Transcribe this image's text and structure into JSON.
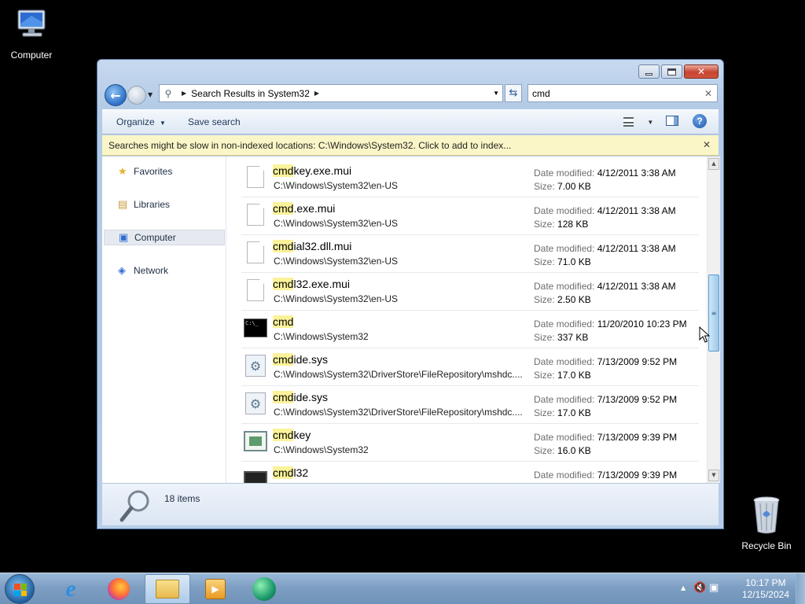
{
  "desktop": {
    "icons": [
      {
        "label": "Computer",
        "icon": "computer-icon"
      },
      {
        "label": "Recycle Bin",
        "icon": "recycle-bin-icon"
      }
    ]
  },
  "window": {
    "caption_buttons": {
      "minimize": "minimize",
      "maximize": "maximize",
      "close": "✕"
    },
    "address": {
      "segments": [
        "Search Results in System32"
      ]
    },
    "search": {
      "value": "cmd"
    },
    "toolbar": {
      "organize_label": "Organize",
      "save_search_label": "Save search"
    },
    "infobar": {
      "text": "Searches might be slow in non-indexed locations: C:\\Windows\\System32. Click to add to index..."
    },
    "navpane": {
      "items": [
        {
          "label": "Favorites",
          "icon": "star-icon",
          "selected": false
        },
        {
          "label": "Libraries",
          "icon": "libraries-icon",
          "selected": false
        },
        {
          "label": "Computer",
          "icon": "computer-icon",
          "selected": true
        },
        {
          "label": "Network",
          "icon": "network-icon",
          "selected": false
        }
      ]
    },
    "files": {
      "date_key": "Date modified:",
      "size_key": "Size:",
      "rows": [
        {
          "match": "cmd",
          "rest": "key.exe.mui",
          "path": "C:\\Windows\\System32\\en-US",
          "date": "4/12/2011 3:38 AM",
          "size": "7.00 KB",
          "icon": "document-icon"
        },
        {
          "match": "cmd",
          "rest": ".exe.mui",
          "path": "C:\\Windows\\System32\\en-US",
          "date": "4/12/2011 3:38 AM",
          "size": "128 KB",
          "icon": "document-icon"
        },
        {
          "match": "cmd",
          "rest": "ial32.dll.mui",
          "path": "C:\\Windows\\System32\\en-US",
          "date": "4/12/2011 3:38 AM",
          "size": "71.0 KB",
          "icon": "document-icon"
        },
        {
          "match": "cmd",
          "rest": "l32.exe.mui",
          "path": "C:\\Windows\\System32\\en-US",
          "date": "4/12/2011 3:38 AM",
          "size": "2.50 KB",
          "icon": "document-icon"
        },
        {
          "match": "cmd",
          "rest": "",
          "path": "C:\\Windows\\System32",
          "date": "11/20/2010 10:23 PM",
          "size": "337 KB",
          "icon": "command-prompt-icon"
        },
        {
          "match": "cmd",
          "rest": "ide.sys",
          "path": "C:\\Windows\\System32\\DriverStore\\FileRepository\\mshdc....",
          "date": "7/13/2009 9:52 PM",
          "size": "17.0 KB",
          "icon": "system-file-icon"
        },
        {
          "match": "cmd",
          "rest": "ide.sys",
          "path": "C:\\Windows\\System32\\DriverStore\\FileRepository\\mshdc....",
          "date": "7/13/2009 9:52 PM",
          "size": "17.0 KB",
          "icon": "system-file-icon"
        },
        {
          "match": "cmd",
          "rest": "key",
          "path": "C:\\Windows\\System32",
          "date": "7/13/2009 9:39 PM",
          "size": "16.0 KB",
          "icon": "cmdkey-icon"
        },
        {
          "match": "cmd",
          "rest": "l32",
          "path": "",
          "date": "7/13/2009 9:39 PM",
          "size": "",
          "icon": "cmdl32-icon"
        }
      ]
    },
    "details": {
      "count": "18 items"
    }
  },
  "taskbar": {
    "apps": [
      {
        "name": "Internet Explorer",
        "icon": "internet-explorer-icon",
        "active": false
      },
      {
        "name": "Firefox",
        "icon": "firefox-icon",
        "active": false
      },
      {
        "name": "Windows Explorer",
        "icon": "folder-icon",
        "active": true
      },
      {
        "name": "Media Player",
        "icon": "media-player-icon",
        "active": false
      },
      {
        "name": "App",
        "icon": "app-icon",
        "active": false
      }
    ],
    "clock": {
      "time": "10:17 PM",
      "date": "12/15/2024"
    }
  },
  "colors": {
    "highlight": "#fbf29a",
    "infobar": "#fbf6c7",
    "window_frame": "#b6cde8",
    "taskbar": "#7e9fc3"
  }
}
